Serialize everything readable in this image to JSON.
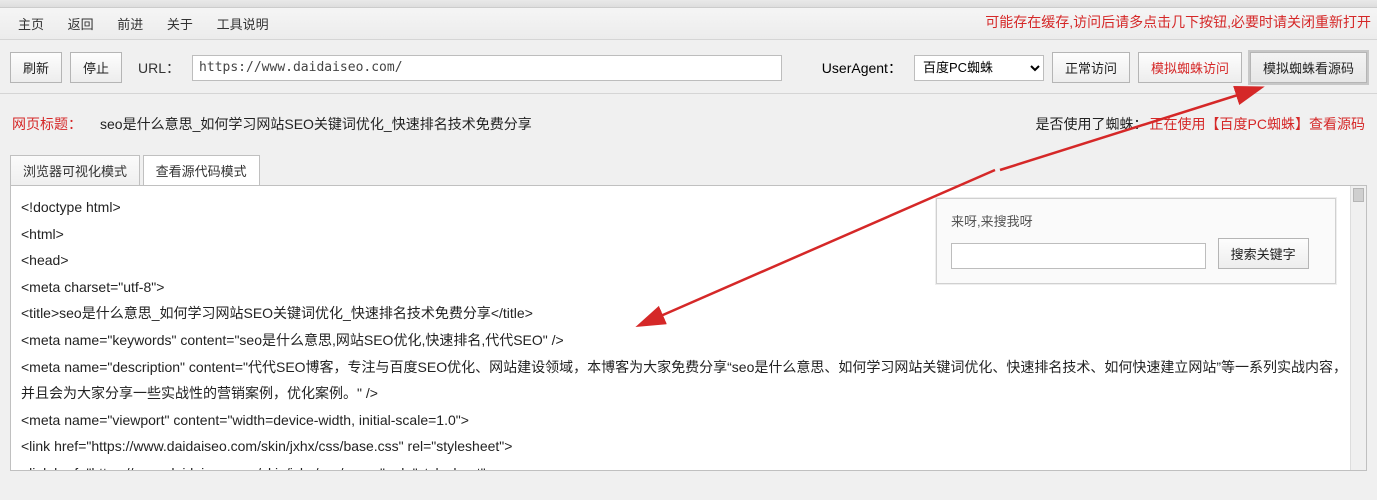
{
  "menu": {
    "items": [
      "主页",
      "返回",
      "前进",
      "关于",
      "工具说明"
    ]
  },
  "cache_hint": "可能存在缓存,访问后请多点击几下按钮,必要时请关闭重新打开",
  "toolbar": {
    "refresh": "刷新",
    "stop": "停止",
    "url_label": "URL：",
    "url_value": "https://www.daidaiseo.com/",
    "ua_label": "UserAgent：",
    "ua_selected": "百度PC蜘蛛",
    "normal_visit": "正常访问",
    "spider_visit": "模拟蜘蛛访问",
    "spider_source": "模拟蜘蛛看源码"
  },
  "info": {
    "title_label": "网页标题：",
    "title_value": "seo是什么意思_如何学习网站SEO关键词优化_快速排名技术免费分享",
    "spider_label": "是否使用了蜘蛛：",
    "spider_value": "正在使用【百度PC蜘蛛】查看源码"
  },
  "tabs": {
    "visual": "浏览器可视化模式",
    "source": "查看源代码模式"
  },
  "search": {
    "placeholder": "来呀,来搜我呀",
    "button": "搜索关键字"
  },
  "source_lines": [
    "<!doctype html>",
    "<html>",
    "<head>",
    "<meta charset=\"utf-8\">",
    "<title>seo是什么意思_如何学习网站SEO关键词优化_快速排名技术免费分享</title>",
    "<meta name=\"keywords\" content=\"seo是什么意思,网站SEO优化,快速排名,代代SEO\" />",
    "<meta name=\"description\" content=\"代代SEO博客，专注与百度SEO优化、网站建设领域，本博客为大家免费分享“seo是什么意思、如何学习网站关键词优化、快速排名技术、如何快速建立网站”等一系列实战内容，并且会为大家分享一些实战性的营销案例，优化案例。\" />",
    "<meta name=\"viewport\" content=\"width=device-width, initial-scale=1.0\">",
    "<link href=\"https://www.daidaiseo.com/skin/jxhx/css/base.css\" rel=\"stylesheet\">",
    "<link href=\"https://www.daidaiseo.com/skin/jxhx/css/m.css\" rel=\"stylesheet\">"
  ]
}
